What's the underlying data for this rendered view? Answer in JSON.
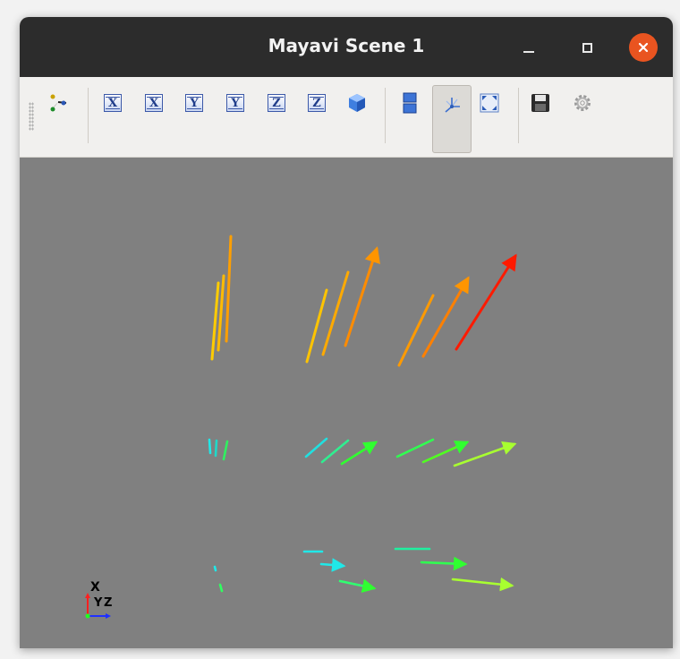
{
  "window": {
    "title": "Mayavi Scene 1"
  },
  "titlebar_buttons": [
    "minimize-icon",
    "maximize-icon",
    "close-icon"
  ],
  "toolbar": {
    "buttons": [
      {
        "name": "mayavi-logo-icon"
      },
      {
        "name": "view-x-plus-button",
        "label": "X"
      },
      {
        "name": "view-x-minus-button",
        "label": "X"
      },
      {
        "name": "view-y-plus-button",
        "label": "Y"
      },
      {
        "name": "view-y-minus-button",
        "label": "Y"
      },
      {
        "name": "view-z-plus-button",
        "label": "Z"
      },
      {
        "name": "view-z-minus-button",
        "label": "Z"
      },
      {
        "name": "isometric-view-button"
      },
      {
        "name": "parallel-projection-button"
      },
      {
        "name": "toggle-axes-button",
        "pressed": true
      },
      {
        "name": "fullscreen-button"
      },
      {
        "name": "save-button"
      },
      {
        "name": "settings-button"
      }
    ]
  },
  "orientation_axes": {
    "x_label": "X",
    "y_label": "Y",
    "z_label": "Z"
  },
  "colors": {
    "scene_background": "#808080",
    "titlebar": "#2c2c2c",
    "close_button": "#e95420"
  }
}
